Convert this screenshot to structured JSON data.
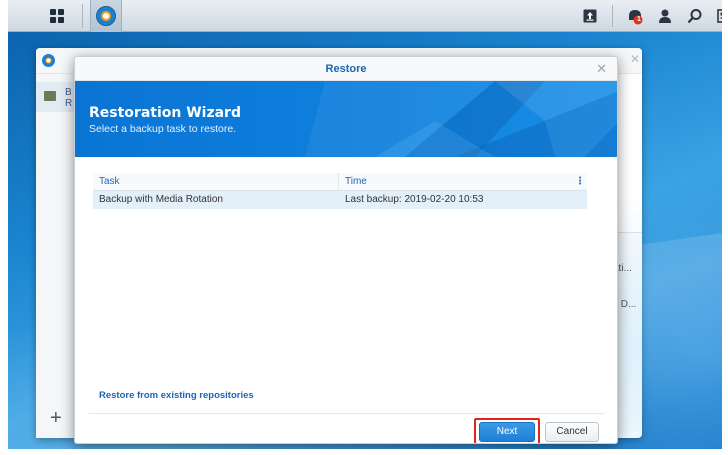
{
  "taskbar": {
    "main_menu_icon": "grid-apps-icon",
    "app_icon": "hyper-backup-icon",
    "right_icons": [
      "upload-icon",
      "notifications-icon",
      "user-icon",
      "search-icon",
      "widgets-icon"
    ],
    "notification_count": "1"
  },
  "background_window": {
    "sidebar_item_line1": "B",
    "sidebar_item_line2": "R",
    "panel_text_1": "ati...",
    "panel_text_2": "l: D..."
  },
  "modal": {
    "title": "Restore",
    "banner_title": "Restoration Wizard",
    "banner_subtitle": "Select a backup task to restore.",
    "table": {
      "columns": [
        "Task",
        "Time"
      ],
      "rows": [
        {
          "task": "Backup with Media Rotation",
          "time": "Last backup: 2019-02-20 10:53"
        }
      ]
    },
    "restore_link": "Restore from existing repositories",
    "next_label": "Next",
    "cancel_label": "Cancel"
  },
  "colors": {
    "accent": "#1d66b5",
    "banner": "#0f80dd",
    "highlight_box": "#e0241b"
  }
}
